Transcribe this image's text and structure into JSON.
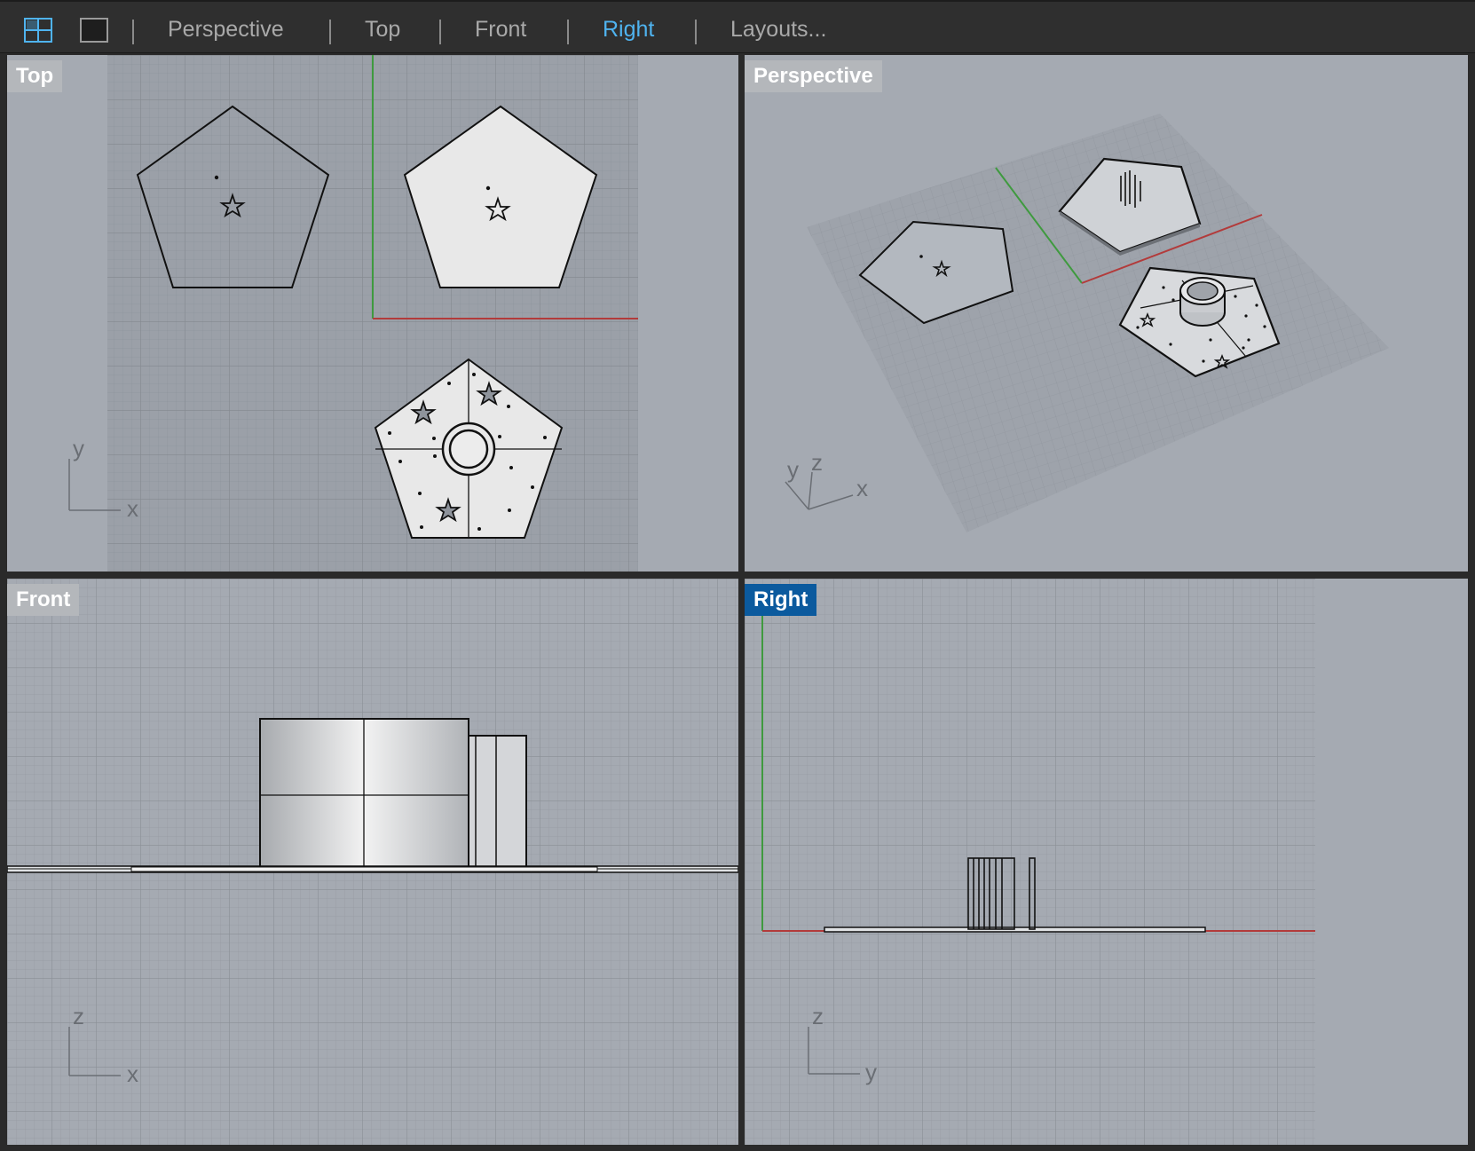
{
  "toolbar": {
    "icons": [
      "four-viewport-layout-icon",
      "single-viewport-layout-icon"
    ],
    "tabs": [
      {
        "label": "Perspective",
        "active": false
      },
      {
        "label": "Top",
        "active": false
      },
      {
        "label": "Front",
        "active": false
      },
      {
        "label": "Right",
        "active": true
      },
      {
        "label": "Layouts...",
        "active": false
      }
    ],
    "active_color": "#4fb3ef"
  },
  "viewports": {
    "top": {
      "title": "Top",
      "axis_x": "x",
      "axis_y": "y"
    },
    "perspective": {
      "title": "Perspective",
      "axis_x": "x",
      "axis_y": "y",
      "axis_z": "z"
    },
    "front": {
      "title": "Front",
      "axis_x": "x",
      "axis_z": "z"
    },
    "right": {
      "title": "Right",
      "axis_y": "y",
      "axis_z": "z",
      "active": true
    }
  },
  "colors": {
    "viewport_bg": "#a5aab2",
    "grid_bg": "#9aa0a8",
    "x_axis": "#b23b3b",
    "y_axis": "#3f9a3f",
    "active_title": "#0b5a9e"
  }
}
